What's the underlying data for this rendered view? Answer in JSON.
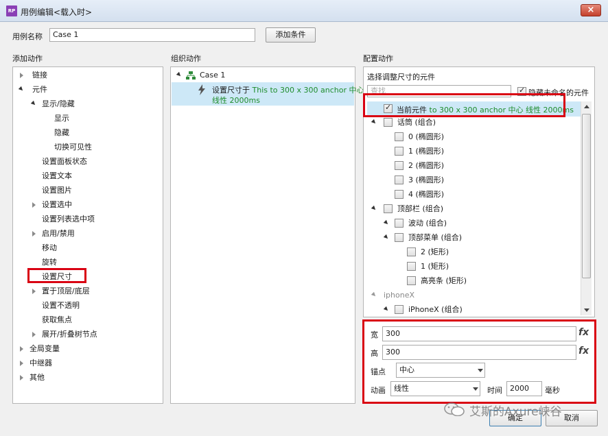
{
  "window": {
    "title": "用例编辑<载入时>",
    "app_icon": "RP",
    "close_glyph": "×"
  },
  "case": {
    "name_label": "用例名称",
    "name_value": "Case 1",
    "add_condition": "添加条件"
  },
  "columns": {
    "add_action": "添加动作",
    "organize_action": "组织动作",
    "configure_action": "配置动作"
  },
  "actions_tree": [
    {
      "label": "链接"
    },
    {
      "label": "元件"
    },
    {
      "label": "显示/隐藏"
    },
    {
      "label": "显示"
    },
    {
      "label": "隐藏"
    },
    {
      "label": "切换可见性"
    },
    {
      "label": "设置面板状态"
    },
    {
      "label": "设置文本"
    },
    {
      "label": "设置图片"
    },
    {
      "label": "设置选中"
    },
    {
      "label": "设置列表选中项"
    },
    {
      "label": "启用/禁用"
    },
    {
      "label": "移动"
    },
    {
      "label": "旋转"
    },
    {
      "label": "设置尺寸"
    },
    {
      "label": "置于顶层/底层"
    },
    {
      "label": "设置不透明"
    },
    {
      "label": "获取焦点"
    },
    {
      "label": "展开/折叠树节点"
    },
    {
      "label": "全局变量"
    },
    {
      "label": "中继器"
    },
    {
      "label": "其他"
    }
  ],
  "organize": {
    "case_label": "Case 1",
    "action_prefix": "设置尺寸于",
    "action_line1": "This to 300 x 300 anchor 中心",
    "action_line2": "线性 2000ms"
  },
  "configure": {
    "select_label": "选择调整尺寸的元件",
    "search_placeholder": "查找",
    "hide_unnamed": "隐藏未命名的元件",
    "current_prefix": "当前元件",
    "current_detail": "to 300 x 300 anchor 中心 线性 2000ms",
    "widgets": [
      {
        "label": "话筒 (组合)"
      },
      {
        "label": "0 (椭圆形)"
      },
      {
        "label": "1 (椭圆形)"
      },
      {
        "label": "2 (椭圆形)"
      },
      {
        "label": "3 (椭圆形)"
      },
      {
        "label": "4 (椭圆形)"
      },
      {
        "label": "顶部栏 (组合)"
      },
      {
        "label": "波动 (组合)"
      },
      {
        "label": "顶部菜单 (组合)"
      },
      {
        "label": "2 (矩形)"
      },
      {
        "label": "1 (矩形)"
      },
      {
        "label": "高亮条 (矩形)"
      },
      {
        "label": "iphoneX"
      },
      {
        "label": "iPhoneX (组合)"
      }
    ],
    "width_label": "宽",
    "width_value": "300",
    "height_label": "高",
    "height_value": "300",
    "fx": "fx",
    "anchor_label": "锚点",
    "anchor_value": "中心",
    "anim_label": "动画",
    "anim_value": "线性",
    "time_label": "时间",
    "time_value": "2000",
    "time_unit": "毫秒"
  },
  "footer": {
    "ok": "确定",
    "cancel": "取消",
    "watermark": "艾斯的Axure峡谷"
  },
  "colors": {
    "highlight_red": "#d90012",
    "selection_blue": "#cde8f7",
    "green_text": "#1e8c2b"
  }
}
